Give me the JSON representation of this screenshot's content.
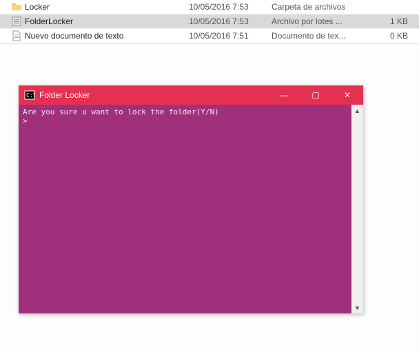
{
  "files": [
    {
      "name": "Locker",
      "date": "10/05/2016 7:53",
      "type": "Carpeta de archivos",
      "size": "",
      "icon": "folder"
    },
    {
      "name": "FolderLocker",
      "date": "10/05/2016 7:53",
      "type": "Archivo por lotes ...",
      "size": "1 KB",
      "icon": "batch",
      "selected": true
    },
    {
      "name": "Nuevo documento de texto",
      "date": "10/05/2016 7:51",
      "type": "Documento de tex...",
      "size": "0 KB",
      "icon": "text"
    }
  ],
  "console": {
    "title": "Folder Locker",
    "line1": "Are you sure u want to lock the folder(Y/N)",
    "line2": ">"
  },
  "winControls": {
    "minimize": "—",
    "maximize": "▢",
    "close": "✕"
  },
  "scroll": {
    "up": "▲",
    "down": "▼"
  }
}
